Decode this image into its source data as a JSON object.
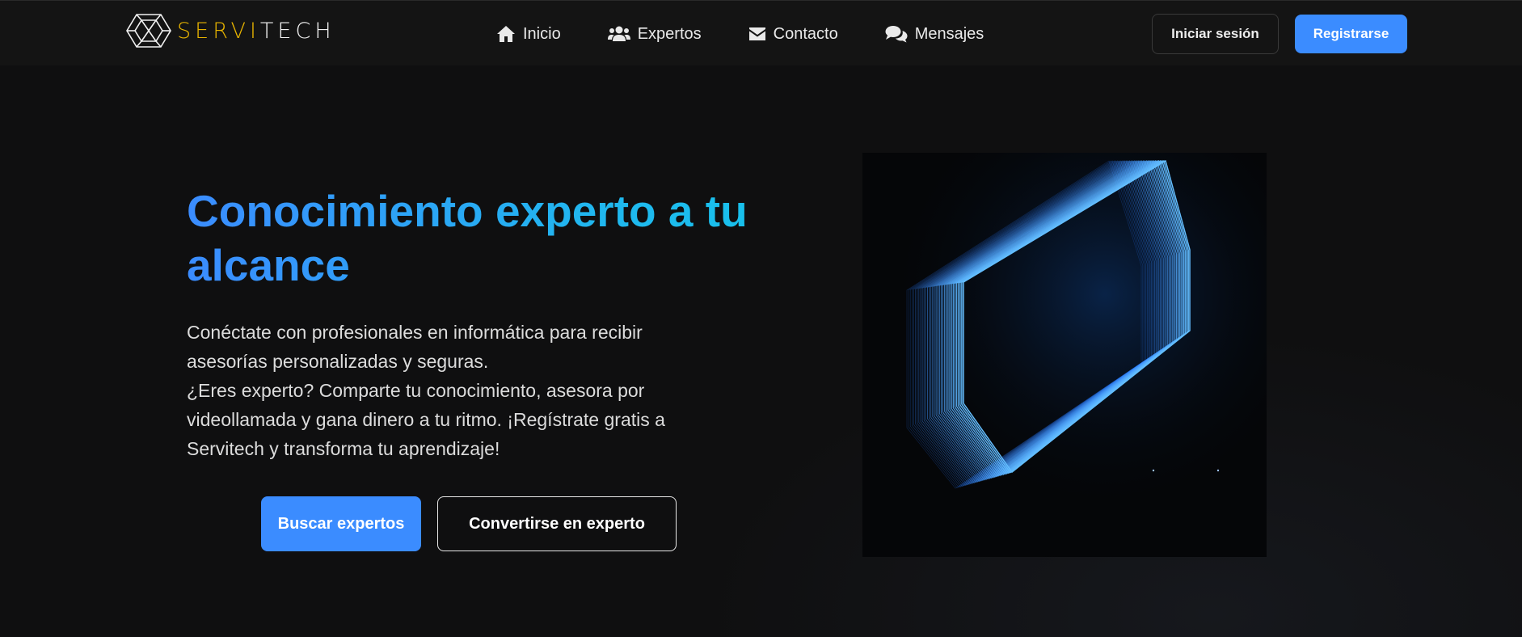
{
  "brand": {
    "name_part1": "SERVI",
    "name_part2": "TECH",
    "accent_color": "#e8b400"
  },
  "nav": {
    "items": [
      {
        "label": "Inicio",
        "icon": "home-icon"
      },
      {
        "label": "Expertos",
        "icon": "users-icon"
      },
      {
        "label": "Contacto",
        "icon": "envelope-icon"
      },
      {
        "label": "Mensajes",
        "icon": "comments-icon"
      }
    ],
    "login_label": "Iniciar sesión",
    "register_label": "Registrarse"
  },
  "hero": {
    "title": "Conocimiento experto a tu alcance",
    "description_1": "Conéctate con profesionales en informática para recibir asesorías personalizadas y seguras.",
    "description_2": "¿Eres experto? Comparte tu conocimiento, asesora por videollamada y gana dinero a tu ritmo. ¡Regístrate gratis a Servitech y transforma tu aprendizaje!",
    "primary_button": "Buscar expertos",
    "secondary_button": "Convertirse en experto"
  },
  "colors": {
    "primary": "#3b8cff",
    "title_gradient_end": "#18c0ec",
    "background": "#0f0f10",
    "navbar": "#141414"
  }
}
